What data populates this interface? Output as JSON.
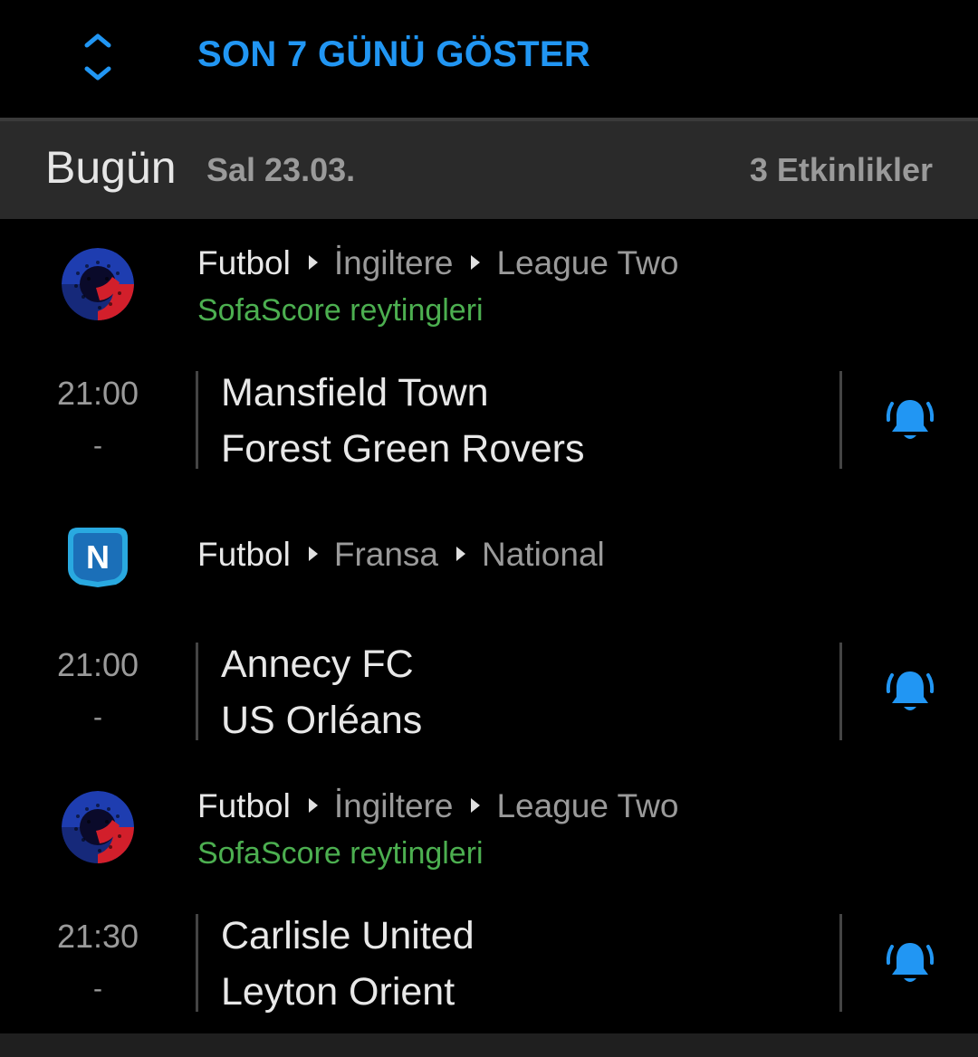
{
  "header": {
    "show_days_label": "SON 7 GÜNÜ GÖSTER",
    "icon": "expand-collapse-icon",
    "accent_color": "#2196f3"
  },
  "date_section": {
    "title": "Bugün",
    "date": "Sal 23.03.",
    "events_count": "3 Etkinlikler"
  },
  "leagues": [
    {
      "sport": "Futbol",
      "country": "İngiltere",
      "league": "League Two",
      "rating_label": "SofaScore reytingleri",
      "logo": "league-two-logo",
      "match": {
        "time": "21:00",
        "status": "-",
        "home": "Mansfield Town",
        "away": "Forest Green Rovers"
      }
    },
    {
      "sport": "Futbol",
      "country": "Fransa",
      "league": "National",
      "logo_letter": "N",
      "logo": "national-logo",
      "match": {
        "time": "21:00",
        "status": "-",
        "home": "Annecy FC",
        "away": "US Orléans"
      }
    },
    {
      "sport": "Futbol",
      "country": "İngiltere",
      "league": "League Two",
      "rating_label": "SofaScore reytingleri",
      "logo": "league-two-logo",
      "match": {
        "time": "21:30",
        "status": "-",
        "home": "Carlisle United",
        "away": "Leyton Orient"
      }
    }
  ],
  "colors": {
    "background": "#000000",
    "header_bg": "#2a2a2a",
    "rating_green": "#4caf50",
    "bell_blue": "#2196f3"
  }
}
